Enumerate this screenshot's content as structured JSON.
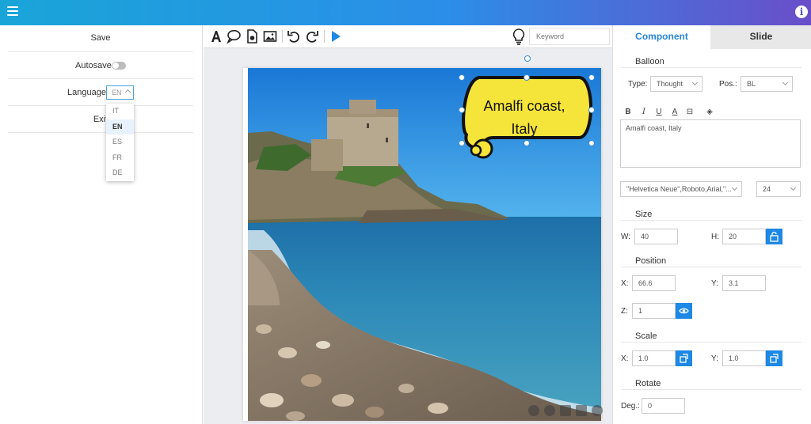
{
  "left": {
    "save": "Save",
    "autosave": "Autosave",
    "language_label": "Language",
    "language_value": "EN",
    "exit": "Exit",
    "language_options": [
      "IT",
      "EN",
      "ES",
      "FR",
      "DE"
    ]
  },
  "toolbar": {
    "keyword_placeholder": "Keyword"
  },
  "balloon": {
    "text_line1": "Amalfi coast,",
    "text_line2": "Italy"
  },
  "right": {
    "tabs": [
      "Component",
      "Slide"
    ],
    "balloon_section": "Balloon",
    "type_label": "Type:",
    "type_value": "Thought",
    "pos_label": "Pos.:",
    "pos_value": "BL",
    "text_value": "Amalfi coast, Italy",
    "font_value": "\"Helvetica Neue\",Roboto,Arial,\"...",
    "font_size": "24",
    "size_section": "Size",
    "w_label": "W:",
    "w_value": "40",
    "h_label": "H:",
    "h_value": "20",
    "position_section": "Position",
    "x_label": "X:",
    "x_value": "66.6",
    "y_label": "Y:",
    "y_value": "3.1",
    "z_label": "Z:",
    "z_value": "1",
    "scale_section": "Scale",
    "sx_label": "X:",
    "sx_value": "1.0",
    "sy_label": "Y:",
    "sy_value": "1.0",
    "rotate_section": "Rotate",
    "deg_label": "Deg.:",
    "deg_value": "0"
  },
  "colors": {
    "accent": "#2a86d8",
    "balloon_fill": "#f5e43a",
    "button_blue": "#1e88e5"
  }
}
